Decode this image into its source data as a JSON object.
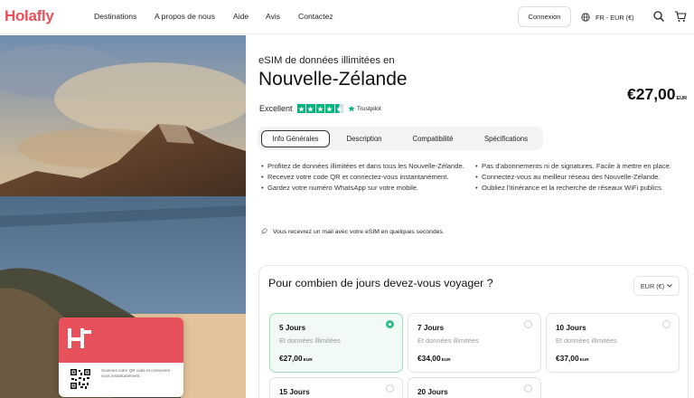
{
  "nav": {
    "logo": "Holafly",
    "links": [
      "Destinations",
      "A propos de nous",
      "Aide",
      "Avis",
      "Contactez"
    ],
    "login": "Connexion",
    "lang": "FR - EUR (€)",
    "icons": [
      "globe-icon",
      "search-icon",
      "cart-icon"
    ]
  },
  "card": {
    "text": "Scannez votre QR code et connectez-vous instantanément."
  },
  "product": {
    "subtitle": "eSIM de données illimitées en",
    "title": "Nouvelle-Zélande",
    "price": "€27,00",
    "price_currency": "EUR",
    "rating_label": "Excellent",
    "trustpilot": "Trustpilot",
    "stars": 4.5,
    "tabs": [
      "Info Générales",
      "Description",
      "Compatibilité",
      "Spécifications"
    ],
    "active_tab": "Info Générales",
    "features_left": [
      "Profitez de données illimitées et dans tous les Nouvelle-Zélande.",
      "Recevez votre code QR et connectez-vous instantanément.",
      "Gardez votre numéro WhatsApp sur votre mobile."
    ],
    "features_right": [
      "Pas d'abonnements ni de signatures. Facile à mettre en place.",
      "Connectez-vous au meilleur réseau des Nouvelle-Zélande.",
      "Oubliez l'itinérance et la recherche de réseaux WiFi publics."
    ],
    "mail_note": "Vous recevrez un mail avec votre eSIM en quelques secondes."
  },
  "duration": {
    "title": "Pour combien de jours devez-vous voyager ?",
    "currency_select": "EUR (€)",
    "plans": [
      {
        "days": "5 Jours",
        "data": "Et données illimitées",
        "price": "€27,00",
        "currency": "EUR",
        "selected": true
      },
      {
        "days": "7 Jours",
        "data": "Et données illimitées",
        "price": "€34,00",
        "currency": "EUR",
        "selected": false
      },
      {
        "days": "10 Jours",
        "data": "Et données illimitées",
        "price": "€37,00",
        "currency": "EUR",
        "selected": false
      },
      {
        "days": "15 Jours",
        "data": "",
        "price": "",
        "currency": "",
        "selected": false
      },
      {
        "days": "20 Jours",
        "data": "",
        "price": "",
        "currency": "",
        "selected": false
      }
    ]
  },
  "colors": {
    "brand": "#e8505b",
    "trustpilot": "#00b67a",
    "selected_border": "#9bdcb9",
    "selected_radio": "#2ebd85"
  }
}
